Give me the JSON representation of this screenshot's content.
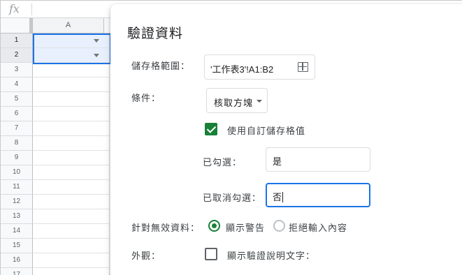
{
  "formula_bar": {
    "fx_label": "fx"
  },
  "grid": {
    "column_header": "A",
    "row_numbers": [
      "1",
      "2",
      "3",
      "4",
      "5",
      "6",
      "7",
      "8",
      "9",
      "10",
      "11",
      "12",
      "13",
      "14",
      "15",
      "16",
      "17"
    ],
    "selected_rows": [
      "1",
      "2"
    ]
  },
  "dialog": {
    "title": "驗證資料",
    "cell_range": {
      "label": "儲存格範圍：",
      "value": "'工作表3'!A1:B2",
      "icon": "grid-icon"
    },
    "criteria": {
      "label": "條件：",
      "selected": "核取方塊",
      "custom_values": {
        "label": "使用自訂儲存格值",
        "checked": true
      },
      "checked_field": {
        "label": "已勾選：",
        "value": "是"
      },
      "unchecked_field": {
        "label": "已取消勾選：",
        "value": "否"
      }
    },
    "invalid_data": {
      "label": "針對無效資料：",
      "options": [
        {
          "label": "顯示警告",
          "selected": true
        },
        {
          "label": "拒絕輸入內容",
          "selected": false
        }
      ]
    },
    "appearance": {
      "label": "外觀：",
      "help_text": {
        "label": "顯示驗證說明文字：",
        "checked": false
      }
    }
  },
  "colors": {
    "accent_green": "#188038",
    "focus_blue": "#1a73e8",
    "selection_fill": "#e8f0fe"
  }
}
